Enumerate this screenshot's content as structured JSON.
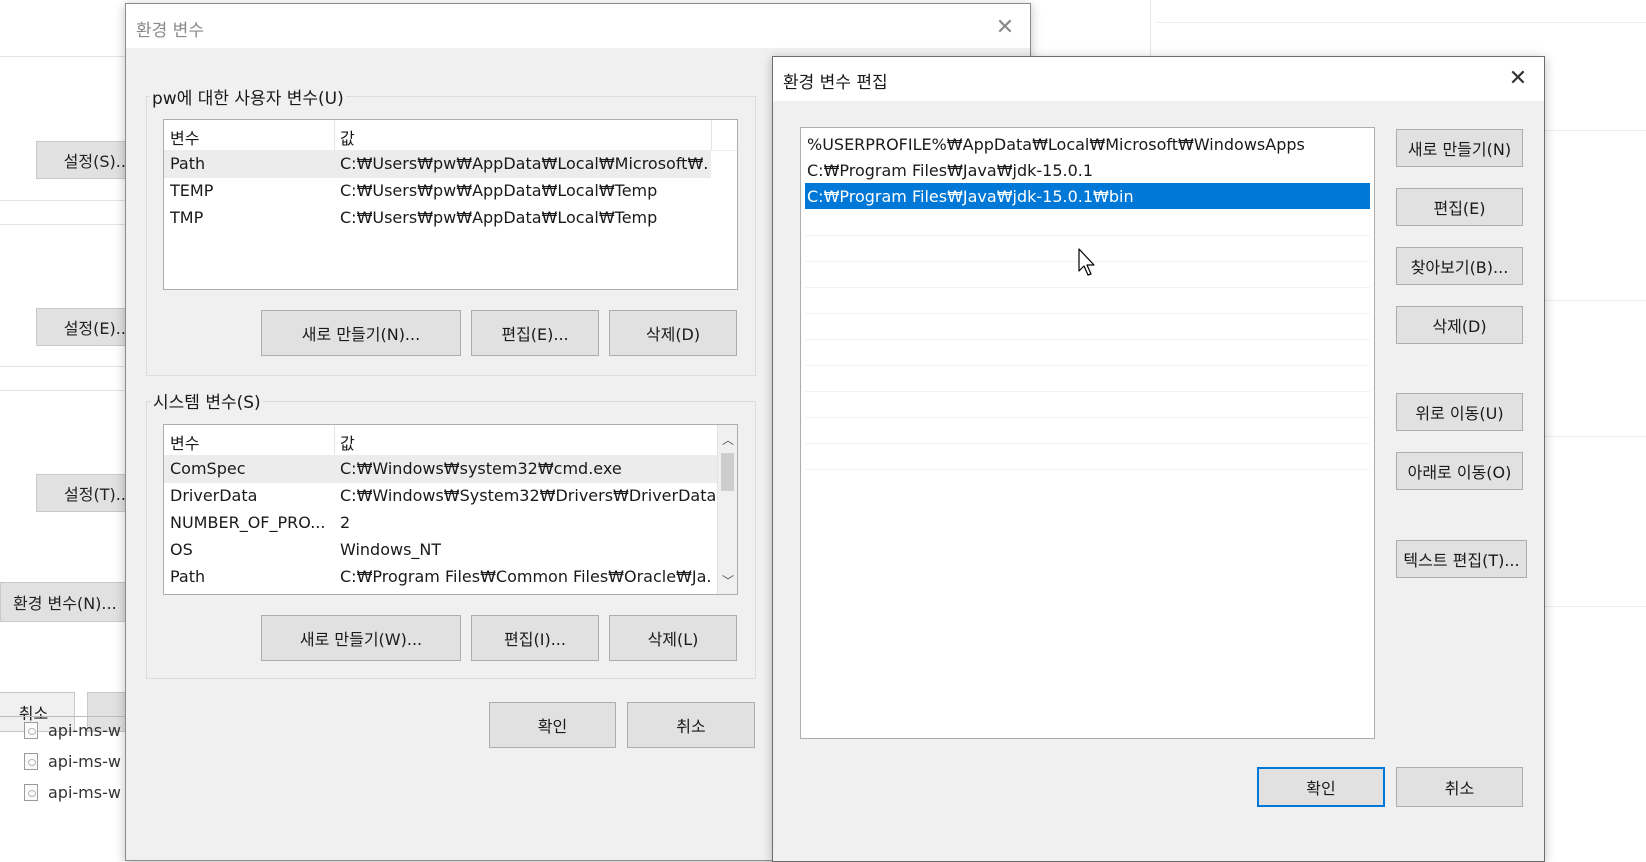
{
  "background_window": {
    "settings_buttons": [
      "설정(S)...",
      "설정(E)...",
      "설정(T)..."
    ],
    "env_button": "환경 변수(N)...",
    "ok_partial": "취소",
    "files": [
      "api-ms-w",
      "api-ms-w",
      "api-ms-w"
    ]
  },
  "env_dialog": {
    "title": "환경 변수",
    "user_group_label": "pw에 대한 사용자 변수(U)",
    "columns": {
      "name": "변수",
      "value": "값"
    },
    "user_vars": [
      {
        "name": "Path",
        "value": "C:₩Users₩pw₩AppData₩Local₩Microsoft₩..."
      },
      {
        "name": "TEMP",
        "value": "C:₩Users₩pw₩AppData₩Local₩Temp"
      },
      {
        "name": "TMP",
        "value": "C:₩Users₩pw₩AppData₩Local₩Temp"
      }
    ],
    "user_buttons": {
      "new": "새로 만들기(N)...",
      "edit": "편집(E)...",
      "delete": "삭제(D)"
    },
    "system_group_label": "시스템 변수(S)",
    "system_vars": [
      {
        "name": "ComSpec",
        "value": "C:₩Windows₩system32₩cmd.exe"
      },
      {
        "name": "DriverData",
        "value": "C:₩Windows₩System32₩Drivers₩DriverData"
      },
      {
        "name": "NUMBER_OF_PRO...",
        "value": "2"
      },
      {
        "name": "OS",
        "value": "Windows_NT"
      },
      {
        "name": "Path",
        "value": "C:₩Program Files₩Common Files₩Oracle₩Ja..."
      }
    ],
    "system_buttons": {
      "new": "새로 만들기(W)...",
      "edit": "편집(I)...",
      "delete": "삭제(L)"
    },
    "ok": "확인",
    "cancel": "취소"
  },
  "edit_dialog": {
    "title": "환경 변수 편집",
    "paths": [
      "%USERPROFILE%₩AppData₩Local₩Microsoft₩WindowsApps",
      "C:₩Program Files₩Java₩jdk-15.0.1",
      "C:₩Program Files₩Java₩jdk-15.0.1₩bin"
    ],
    "selected_index": 2,
    "buttons": {
      "new": "새로 만들기(N)",
      "edit": "편집(E)",
      "browse": "찾아보기(B)...",
      "delete": "삭제(D)",
      "move_up": "위로 이동(U)",
      "move_down": "아래로 이동(O)",
      "text_edit": "텍스트 편집(T)..."
    },
    "ok": "확인",
    "cancel": "취소"
  },
  "colors": {
    "selection": "#0078d7",
    "dialog_bg": "#f0f0f0",
    "button_bg": "#e1e1e1"
  },
  "icons": {
    "close": "close-icon",
    "scroll_up": "chevron-up-icon",
    "scroll_down": "chevron-down-icon",
    "cursor": "mouse-pointer-icon"
  }
}
